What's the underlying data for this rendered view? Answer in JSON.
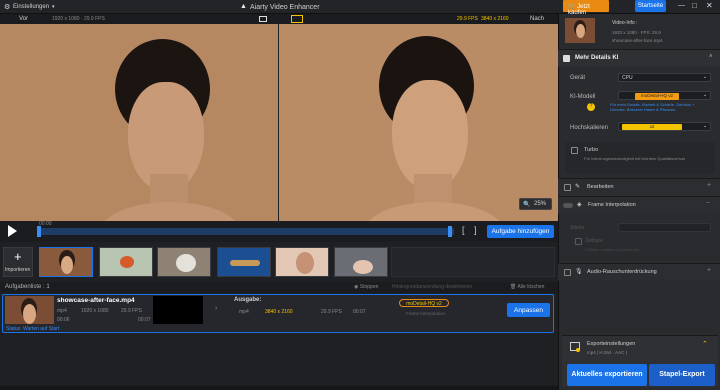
{
  "app": {
    "title": "Aiarty Video Enhancer",
    "settings": "Einstellungen",
    "buy": "Jetzt kaufen",
    "start": "Startseite"
  },
  "compare": {
    "before": "Vor",
    "after": "Nach",
    "before_meta": "1920 x 1080 · 29.9 FPS",
    "after_meta_fps": "29.9 FPS",
    "after_meta_res": "3840 x 2160"
  },
  "timeline": {
    "time": "00:00",
    "zoom": "25%",
    "add_task": "Aufgabe hinzufügen"
  },
  "import": {
    "label": "Importieren"
  },
  "task_bar": {
    "count_label": "Aufgabenliste : 1",
    "stop": "Stoppen",
    "clear_all": "Alle löschen",
    "hint": "Hintergrundanwendung deaktivieren"
  },
  "task": {
    "filename": "showcase-after-face.mp4",
    "fmt": "mp4",
    "res": "1920 x 1080",
    "fps": "29.9 FPS",
    "dur": "00:06",
    "dur2": "00:07",
    "output_label": "Ausgabe:",
    "out_fmt": "mp4",
    "out_res": "3840 x 2160",
    "out_fps": "29.9 FPS",
    "out_dur": "00:07",
    "model": "moDetail-HQ  v2",
    "frame": "Frame Interpolation",
    "adjust": "Anpassen",
    "status": "Status: Warten auf Start"
  },
  "info": {
    "title": "Video-Info :",
    "res": "1920 x 1080 · FPS: 29.9",
    "file": "showcase-after-face.mp4"
  },
  "ai": {
    "section": "Mehr Details KI",
    "device_label": "Gerät",
    "device": "CPU",
    "model_label": "KI-Modell",
    "model": "moDetail-HQ  v2",
    "model_desc": "Für mehr Details, Klarheit & Schärfe. Defokus + Denoise. Besserer Haare & Pflanzen.",
    "upscale_label": "Hochskalieren",
    "upscale": "x2",
    "turbo": "Turbo",
    "turbo_desc": "Für Inferenzgeschwindigkeit mit leichtem Qualitätsverlust"
  },
  "sections": {
    "edit": "Bearbeiten",
    "frame": "Frame Interpolation",
    "stretch": "Stärke",
    "slow": "Zeitlupe",
    "slow_desc": "Zeitlupe erstellen (Videolänge)",
    "audio": "Audio-Rauschunterdrückung"
  },
  "export": {
    "settings": "Exporteinstellungen",
    "format": "mp4 | H.264 · AAC |",
    "current": "Aktuelles exportieren",
    "batch": "Stapel-Export"
  },
  "colors": {
    "accent": "#1a73e8",
    "orange": "#f39c12",
    "yellow": "#f5c400"
  }
}
